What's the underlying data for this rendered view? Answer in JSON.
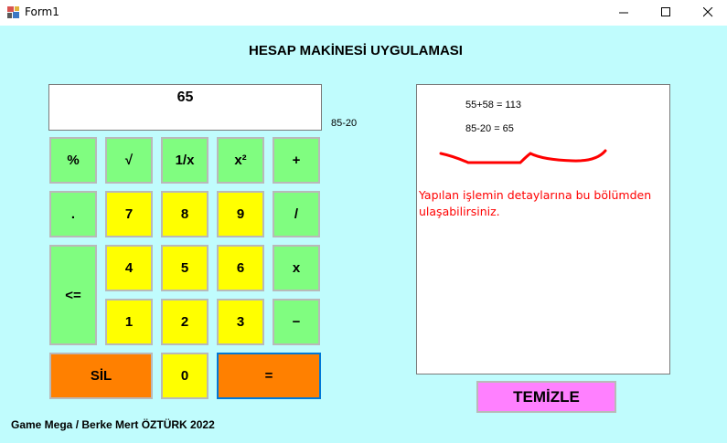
{
  "window": {
    "title": "Form1",
    "controls": {
      "minimize": "minimize-icon",
      "maximize": "maximize-icon",
      "close": "close-icon"
    }
  },
  "heading": "HESAP MAKİNESİ UYGULAMASI",
  "display": {
    "value": "65",
    "pending": "85-20"
  },
  "keys": {
    "percent": "%",
    "sqrt": "√",
    "reciprocal": "1/x",
    "square": "x²",
    "plus": "+",
    "dot": ".",
    "seven": "7",
    "eight": "8",
    "nine": "9",
    "divide": "/",
    "backspace": "<=",
    "four": "4",
    "five": "5",
    "six": "6",
    "multiply": "x",
    "one": "1",
    "two": "2",
    "three": "3",
    "minus": "−",
    "clear": "SİL",
    "zero": "0",
    "equals": "="
  },
  "history": {
    "lines": [
      "55+58 = 113",
      "85-20 = 65"
    ],
    "note": "Yapılan işlemin detaylarına bu bölümden ulaşabilirsiniz."
  },
  "clear_history_button": "TEMİZLE",
  "footer": "Game Mega / Berke Mert ÖZTÜRK 2022",
  "colors": {
    "background": "#c0fcfd",
    "green_key": "#80fd80",
    "yellow_key": "#ffff00",
    "orange_key": "#ff8000",
    "pink_button": "#ff80ff",
    "note_text": "#ff0000"
  }
}
